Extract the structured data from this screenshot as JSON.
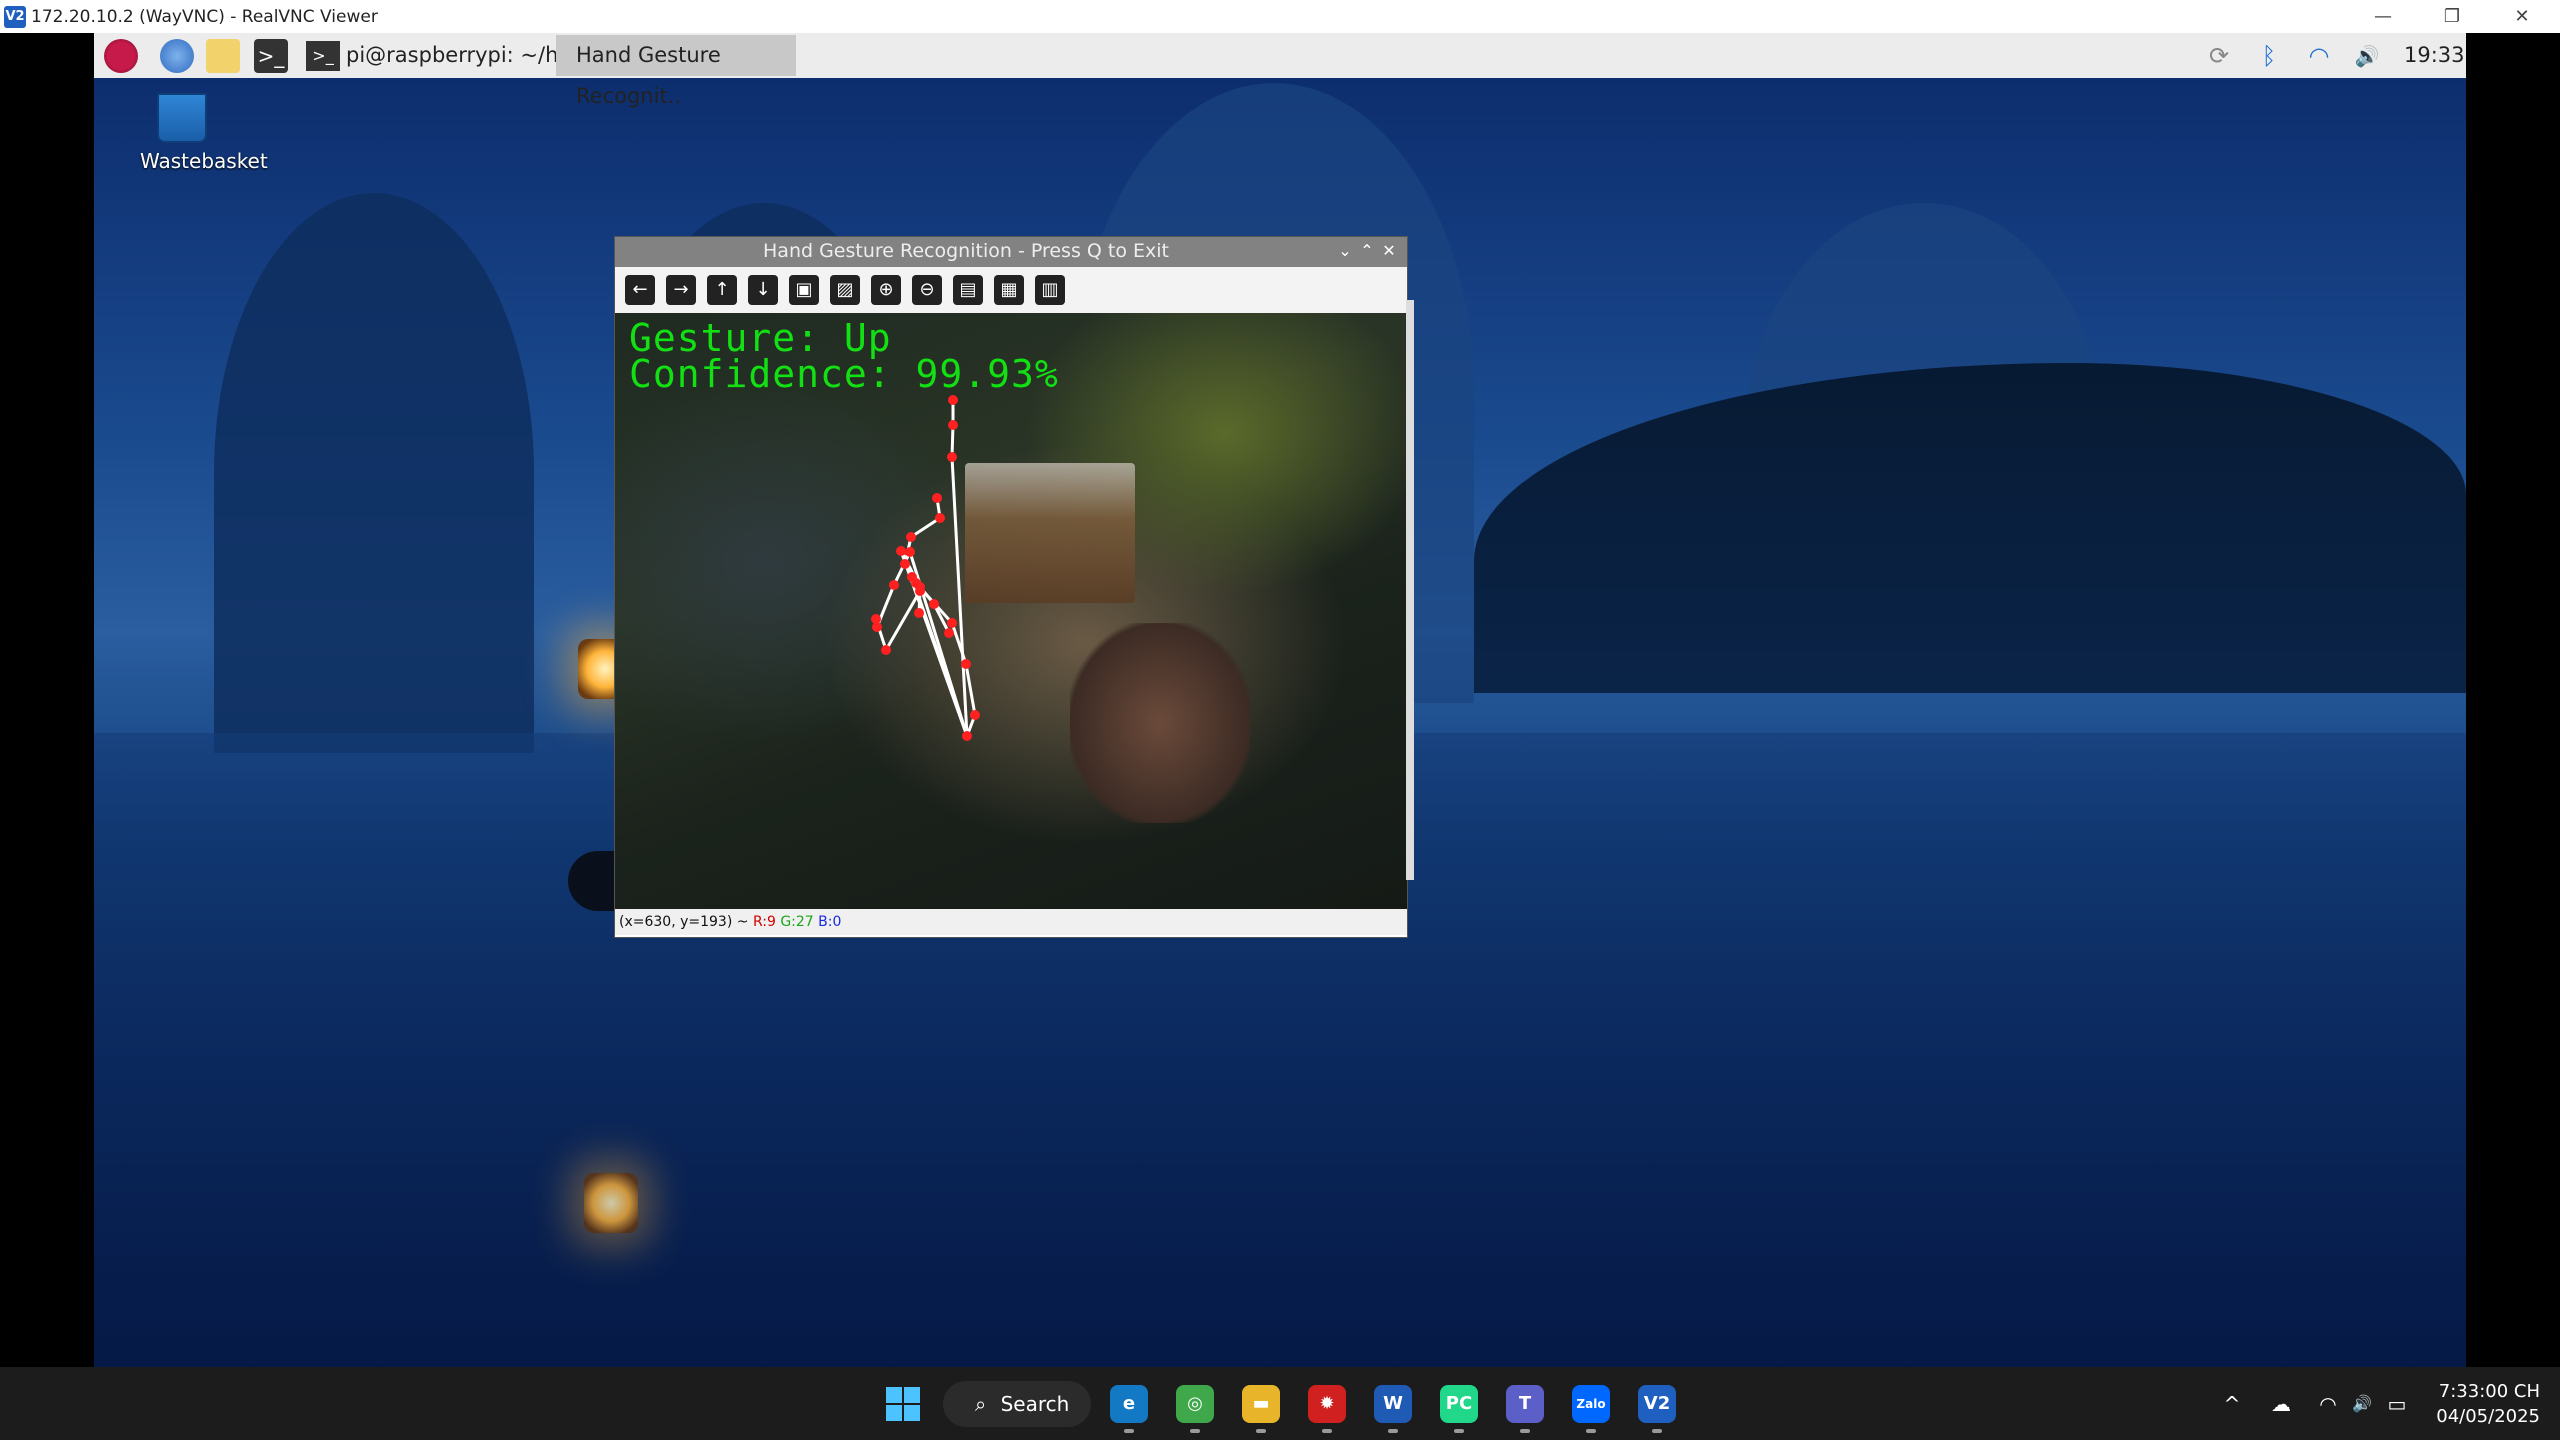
{
  "vnc": {
    "title": "172.20.10.2 (WayVNC) - RealVNC Viewer",
    "app_icon": "V2",
    "controls": {
      "minimize": "—",
      "restore": "❐",
      "close": "✕"
    }
  },
  "pi_panel": {
    "tasks": [
      {
        "label": "pi@raspberrypi: ~/h.."
      },
      {
        "label": "Hand Gesture Recognit.."
      }
    ],
    "clock": "19:33",
    "icons": [
      "raspberry-menu-icon",
      "browser-icon",
      "file-manager-icon",
      "terminal-icon"
    ],
    "tray": {
      "sync": "⟳",
      "bluetooth": "ᛒ",
      "wifi": "◠",
      "volume": "🔊"
    }
  },
  "desktop": {
    "wastebasket_label": "Wastebasket"
  },
  "cv_window": {
    "title": "Hand Gesture Recognition - Press Q to Exit",
    "controls": {
      "minimize": "⌄",
      "maximize": "⌃",
      "close": "✕"
    },
    "toolbar": [
      "←",
      "→",
      "↑",
      "↓",
      "▣",
      "▨",
      "⊕",
      "⊖",
      "▤",
      "▦",
      "▥"
    ],
    "gesture_line": "Gesture: Up",
    "confidence_line": "Confidence: 99.93%",
    "status_prefix": "(x=630, y=193) ~",
    "status_r": "R:9",
    "status_g": "G:27",
    "status_b": "B:0",
    "landmark_color": "#ff2020",
    "skeleton_color": "#ffffff"
  },
  "win_taskbar": {
    "search_label": "Search",
    "apps": [
      {
        "name": "edge-icon",
        "glyph": "e",
        "color": "#1479c4"
      },
      {
        "name": "chrome-alt-icon",
        "glyph": "◎",
        "color": "#3fa84a"
      },
      {
        "name": "file-explorer-icon",
        "glyph": "▬",
        "color": "#e8b52a"
      },
      {
        "name": "security-app-icon",
        "glyph": "✹",
        "color": "#d02020"
      },
      {
        "name": "word-icon",
        "glyph": "W",
        "color": "#1f5bb5"
      },
      {
        "name": "pycharm-icon",
        "glyph": "PC",
        "color": "#21d789"
      },
      {
        "name": "teams-icon",
        "glyph": "T",
        "color": "#5b5fc7"
      },
      {
        "name": "zalo-icon",
        "glyph": "Zalo",
        "color": "#0068ff"
      },
      {
        "name": "realvnc-icon",
        "glyph": "V2",
        "color": "#1f5fbf"
      }
    ],
    "time": "7:33:00 CH",
    "date": "04/05/2025",
    "tray": {
      "chevron": "^",
      "cloud": "☁",
      "wifi": "◠",
      "volume": "🔊",
      "battery": "▭"
    }
  }
}
